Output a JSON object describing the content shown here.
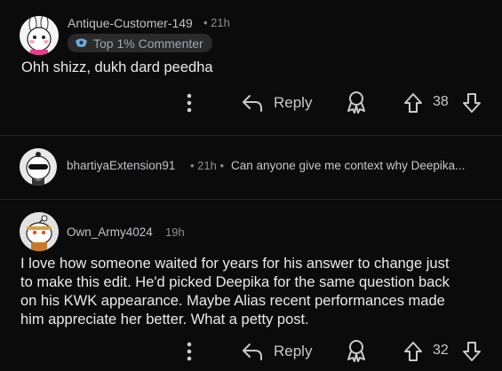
{
  "comments": [
    {
      "username": "Antique-Customer-149",
      "time": "• 21h",
      "badge": "Top 1% Commenter",
      "text": "Ohh shizz, dukh dard peedha",
      "reply_label": "Reply",
      "votes": "38"
    },
    {
      "username": "bhartiyaExtension91",
      "time": "• 21h •",
      "preview": "Can anyone give me context why Deepika..."
    },
    {
      "username": "Own_Army4024",
      "time": "19h",
      "text_lines": [
        "I love how someone waited for years for his answer to change just",
        "to make this edit. He'd picked Deepika for the same question back",
        "on his KWK appearance. Maybe Alias recent performances made",
        "him appreciate her better. What a petty post."
      ],
      "reply_label": "Reply",
      "votes": "32"
    }
  ],
  "icons": {
    "more": "more-vertical-icon",
    "reply": "reply-arrow-icon",
    "award": "award-icon",
    "upvote": "upvote-arrow-icon",
    "downvote": "downvote-arrow-icon"
  },
  "colors": {
    "background": "#0b0b0b",
    "badge_text": "#9aa9b8",
    "meta": "#8b8f92"
  }
}
